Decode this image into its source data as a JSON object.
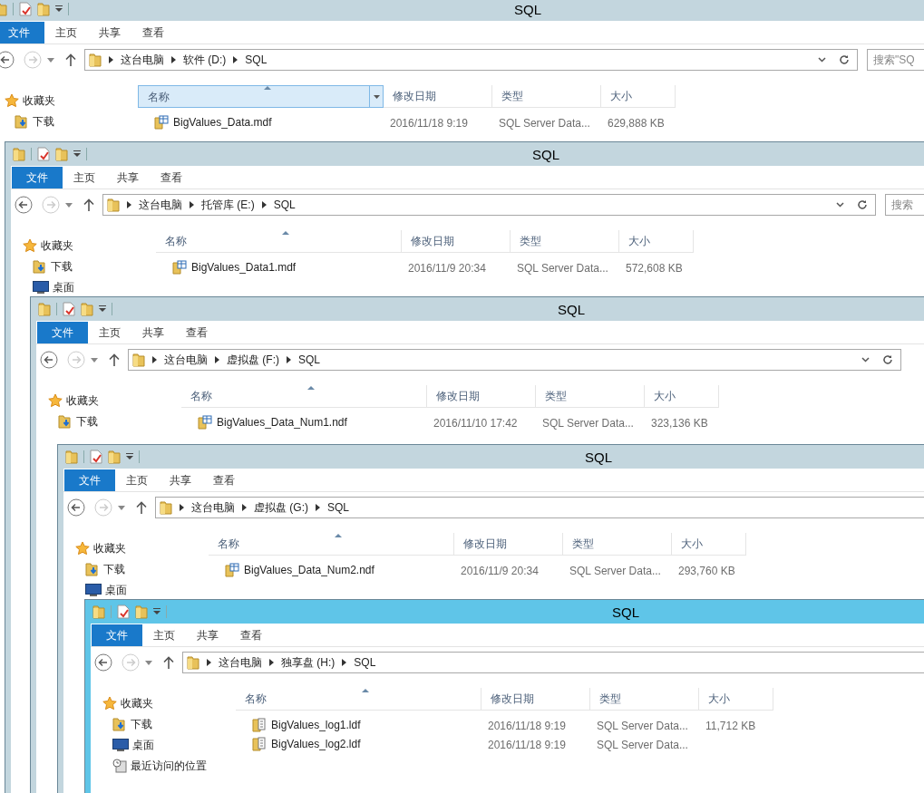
{
  "windows": [
    {
      "title": "SQL",
      "active": false,
      "tabs": [
        {
          "label": "文件",
          "kind": "file_menu"
        },
        {
          "label": "主页",
          "kind": "tab"
        },
        {
          "label": "共享",
          "kind": "tab"
        },
        {
          "label": "查看",
          "kind": "tab"
        }
      ],
      "path": [
        "这台电脑",
        "软件 (D:)",
        "SQL"
      ],
      "search": {
        "placeholder": "搜索\"SQ"
      },
      "sidebar": [
        {
          "label": "收藏夹",
          "kind": "favorites"
        },
        {
          "label": "下载",
          "kind": "downloads"
        }
      ],
      "columns": [
        {
          "label": "名称",
          "hovered": true
        },
        {
          "label": "修改日期",
          "hovered": false
        },
        {
          "label": "类型",
          "hovered": false
        },
        {
          "label": "大小",
          "hovered": false
        }
      ],
      "files": [
        {
          "name": "BigValues_Data.mdf",
          "kind": "data",
          "date": "2016/11/18 9:19",
          "type": "SQL Server Data...",
          "size": "629,888 KB"
        }
      ]
    },
    {
      "title": "SQL",
      "active": false,
      "tabs": [
        {
          "label": "文件",
          "kind": "file_menu"
        },
        {
          "label": "主页",
          "kind": "tab"
        },
        {
          "label": "共享",
          "kind": "tab"
        },
        {
          "label": "查看",
          "kind": "tab"
        }
      ],
      "path": [
        "这台电脑",
        "托管库 (E:)",
        "SQL"
      ],
      "search": {
        "placeholder": "搜索"
      },
      "sidebar": [
        {
          "label": "收藏夹",
          "kind": "favorites"
        },
        {
          "label": "下载",
          "kind": "downloads"
        },
        {
          "label": "桌面",
          "kind": "desktop"
        }
      ],
      "columns": [
        {
          "label": "名称",
          "hovered": false
        },
        {
          "label": "修改日期",
          "hovered": false
        },
        {
          "label": "类型",
          "hovered": false
        },
        {
          "label": "大小",
          "hovered": false
        }
      ],
      "files": [
        {
          "name": "BigValues_Data1.mdf",
          "kind": "data",
          "date": "2016/11/9 20:34",
          "type": "SQL Server Data...",
          "size": "572,608 KB"
        }
      ]
    },
    {
      "title": "SQL",
      "active": false,
      "tabs": [
        {
          "label": "文件",
          "kind": "file_menu"
        },
        {
          "label": "主页",
          "kind": "tab"
        },
        {
          "label": "共享",
          "kind": "tab"
        },
        {
          "label": "查看",
          "kind": "tab"
        }
      ],
      "path": [
        "这台电脑",
        "虚拟盘 (F:)",
        "SQL"
      ],
      "sidebar": [
        {
          "label": "收藏夹",
          "kind": "favorites"
        },
        {
          "label": "下载",
          "kind": "downloads"
        }
      ],
      "columns": [
        {
          "label": "名称",
          "hovered": false
        },
        {
          "label": "修改日期",
          "hovered": false
        },
        {
          "label": "类型",
          "hovered": false
        },
        {
          "label": "大小",
          "hovered": false
        }
      ],
      "files": [
        {
          "name": "BigValues_Data_Num1.ndf",
          "kind": "data",
          "date": "2016/11/10 17:42",
          "type": "SQL Server Data...",
          "size": "323,136 KB"
        }
      ]
    },
    {
      "title": "SQL",
      "active": false,
      "tabs": [
        {
          "label": "文件",
          "kind": "file_menu"
        },
        {
          "label": "主页",
          "kind": "tab"
        },
        {
          "label": "共享",
          "kind": "tab"
        },
        {
          "label": "查看",
          "kind": "tab"
        }
      ],
      "path": [
        "这台电脑",
        "虚拟盘 (G:)",
        "SQL"
      ],
      "sidebar": [
        {
          "label": "收藏夹",
          "kind": "favorites"
        },
        {
          "label": "下载",
          "kind": "downloads"
        },
        {
          "label": "桌面",
          "kind": "desktop"
        }
      ],
      "columns": [
        {
          "label": "名称",
          "hovered": false
        },
        {
          "label": "修改日期",
          "hovered": false
        },
        {
          "label": "类型",
          "hovered": false
        },
        {
          "label": "大小",
          "hovered": false
        }
      ],
      "files": [
        {
          "name": "BigValues_Data_Num2.ndf",
          "kind": "data",
          "date": "2016/11/9 20:34",
          "type": "SQL Server Data...",
          "size": "293,760 KB"
        }
      ]
    },
    {
      "title": "SQL",
      "active": true,
      "tabs": [
        {
          "label": "文件",
          "kind": "file_menu"
        },
        {
          "label": "主页",
          "kind": "tab"
        },
        {
          "label": "共享",
          "kind": "tab"
        },
        {
          "label": "查看",
          "kind": "tab"
        }
      ],
      "path": [
        "这台电脑",
        "独享盘 (H:)",
        "SQL"
      ],
      "sidebar": [
        {
          "label": "收藏夹",
          "kind": "favorites"
        },
        {
          "label": "下载",
          "kind": "downloads"
        },
        {
          "label": "桌面",
          "kind": "desktop"
        },
        {
          "label": "最近访问的位置",
          "kind": "recent"
        }
      ],
      "columns": [
        {
          "label": "名称",
          "hovered": false
        },
        {
          "label": "修改日期",
          "hovered": false
        },
        {
          "label": "类型",
          "hovered": false
        },
        {
          "label": "大小",
          "hovered": false
        }
      ],
      "files": [
        {
          "name": "BigValues_log1.ldf",
          "kind": "log",
          "date": "2016/11/18 9:19",
          "type": "SQL Server Data...",
          "size": "11,712 KB"
        },
        {
          "name": "BigValues_log2.ldf",
          "kind": "log",
          "date": "2016/11/18 9:19",
          "type": "SQL Server Data..."
        }
      ]
    }
  ]
}
